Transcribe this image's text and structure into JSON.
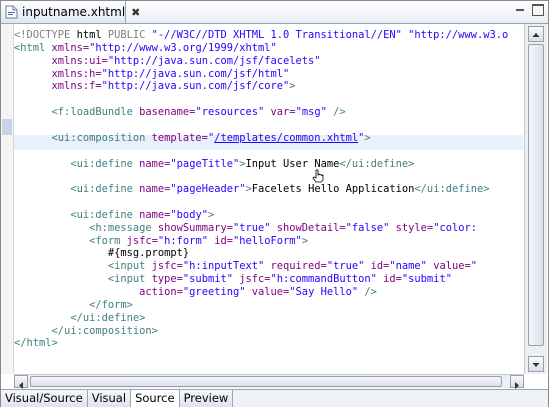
{
  "editor": {
    "tab_title": "inputname.xhtml",
    "close_glyph": "✖",
    "lines": [
      {
        "indent": "",
        "parts": [
          [
            "d",
            "<!DOCTYPE "
          ],
          [
            "k",
            "html "
          ],
          [
            "d",
            "PUBLIC "
          ],
          [
            "v",
            "\"-//W3C//DTD XHTML 1.0 Transitional//EN\" "
          ],
          [
            "v",
            "\"http://www.w3.o"
          ]
        ]
      },
      {
        "indent": "",
        "parts": [
          [
            "t",
            "<html "
          ],
          [
            "a",
            "xmlns="
          ],
          [
            "v",
            "\"http://www.w3.org/1999/xhtml\""
          ]
        ]
      },
      {
        "indent": "      ",
        "parts": [
          [
            "a",
            "xmlns:ui="
          ],
          [
            "v",
            "\"http://java.sun.com/jsf/facelets\""
          ]
        ]
      },
      {
        "indent": "      ",
        "parts": [
          [
            "a",
            "xmlns:h="
          ],
          [
            "v",
            "\"http://java.sun.com/jsf/html\""
          ]
        ]
      },
      {
        "indent": "      ",
        "parts": [
          [
            "a",
            "xmlns:f="
          ],
          [
            "v",
            "\"http://java.sun.com/jsf/core\""
          ],
          [
            "t",
            ">"
          ]
        ]
      },
      {
        "indent": "",
        "parts": []
      },
      {
        "indent": "      ",
        "parts": [
          [
            "t",
            "<f:loadBundle "
          ],
          [
            "a",
            "basename="
          ],
          [
            "v",
            "\"resources\" "
          ],
          [
            "a",
            "var="
          ],
          [
            "v",
            "\"msg\" "
          ],
          [
            "t",
            "/>"
          ]
        ]
      },
      {
        "indent": "",
        "parts": []
      },
      {
        "indent": "      ",
        "parts": [
          [
            "t",
            "<ui:composition "
          ],
          [
            "a",
            "template="
          ],
          [
            "v",
            "\""
          ],
          [
            "u",
            "/templates/common.xhtml"
          ],
          [
            "v",
            "\""
          ],
          [
            "t",
            ">"
          ]
        ]
      },
      {
        "indent": "",
        "parts": []
      },
      {
        "indent": "         ",
        "parts": [
          [
            "t",
            "<ui:define "
          ],
          [
            "a",
            "name="
          ],
          [
            "v",
            "\"pageTitle\""
          ],
          [
            "t",
            ">"
          ],
          [
            "k",
            "Input User Name"
          ],
          [
            "t",
            "</ui:define>"
          ]
        ]
      },
      {
        "indent": "",
        "parts": []
      },
      {
        "indent": "         ",
        "parts": [
          [
            "t",
            "<ui:define "
          ],
          [
            "a",
            "name="
          ],
          [
            "v",
            "\"pageHeader\""
          ],
          [
            "t",
            ">"
          ],
          [
            "k",
            "Facelets Hello Application"
          ],
          [
            "t",
            "</ui:define>"
          ]
        ]
      },
      {
        "indent": "",
        "parts": []
      },
      {
        "indent": "         ",
        "parts": [
          [
            "t",
            "<ui:define "
          ],
          [
            "a",
            "name="
          ],
          [
            "v",
            "\"body\""
          ],
          [
            "t",
            ">"
          ]
        ]
      },
      {
        "indent": "            ",
        "parts": [
          [
            "t",
            "<h:message "
          ],
          [
            "a",
            "showSummary="
          ],
          [
            "v",
            "\"true\" "
          ],
          [
            "a",
            "showDetail="
          ],
          [
            "v",
            "\"false\" "
          ],
          [
            "a",
            "style="
          ],
          [
            "v",
            "\"color:"
          ]
        ]
      },
      {
        "indent": "            ",
        "parts": [
          [
            "t",
            "<form "
          ],
          [
            "a",
            "jsfc="
          ],
          [
            "v",
            "\"h:form\" "
          ],
          [
            "a",
            "id="
          ],
          [
            "v",
            "\"helloForm\""
          ],
          [
            "t",
            ">"
          ]
        ]
      },
      {
        "indent": "               ",
        "parts": [
          [
            "k",
            "#{msg.prompt}"
          ]
        ]
      },
      {
        "indent": "               ",
        "parts": [
          [
            "t",
            "<input "
          ],
          [
            "a",
            "jsfc="
          ],
          [
            "v",
            "\"h:inputText\" "
          ],
          [
            "a",
            "required="
          ],
          [
            "v",
            "\"true\" "
          ],
          [
            "a",
            "id="
          ],
          [
            "v",
            "\"name\" "
          ],
          [
            "a",
            "value="
          ],
          [
            "v",
            "\""
          ]
        ]
      },
      {
        "indent": "               ",
        "parts": [
          [
            "t",
            "<input "
          ],
          [
            "a",
            "type="
          ],
          [
            "v",
            "\"submit\" "
          ],
          [
            "a",
            "jsfc="
          ],
          [
            "v",
            "\"h:commandButton\" "
          ],
          [
            "a",
            "id="
          ],
          [
            "v",
            "\"submit\""
          ]
        ]
      },
      {
        "indent": "                    ",
        "parts": [
          [
            "a",
            "action="
          ],
          [
            "v",
            "\"greeting\" "
          ],
          [
            "a",
            "value="
          ],
          [
            "v",
            "\"Say Hello\" "
          ],
          [
            "t",
            "/>"
          ]
        ]
      },
      {
        "indent": "            ",
        "parts": [
          [
            "t",
            "</form>"
          ]
        ]
      },
      {
        "indent": "         ",
        "parts": [
          [
            "t",
            "</ui:define>"
          ]
        ]
      },
      {
        "indent": "      ",
        "parts": [
          [
            "t",
            "</ui:composition>"
          ]
        ]
      },
      {
        "indent": "",
        "parts": [
          [
            "t",
            "</html>"
          ]
        ]
      }
    ]
  },
  "bottom_tabs": [
    {
      "label": "Visual/Source",
      "active": false
    },
    {
      "label": "Visual",
      "active": false
    },
    {
      "label": "Source",
      "active": true
    },
    {
      "label": "Preview",
      "active": false
    }
  ],
  "colors": {
    "tag": "#3f7f7f",
    "attribute": "#7f007f",
    "value": "#2a00ff",
    "doctype": "#808080",
    "current_line": "#e8f0fc"
  }
}
